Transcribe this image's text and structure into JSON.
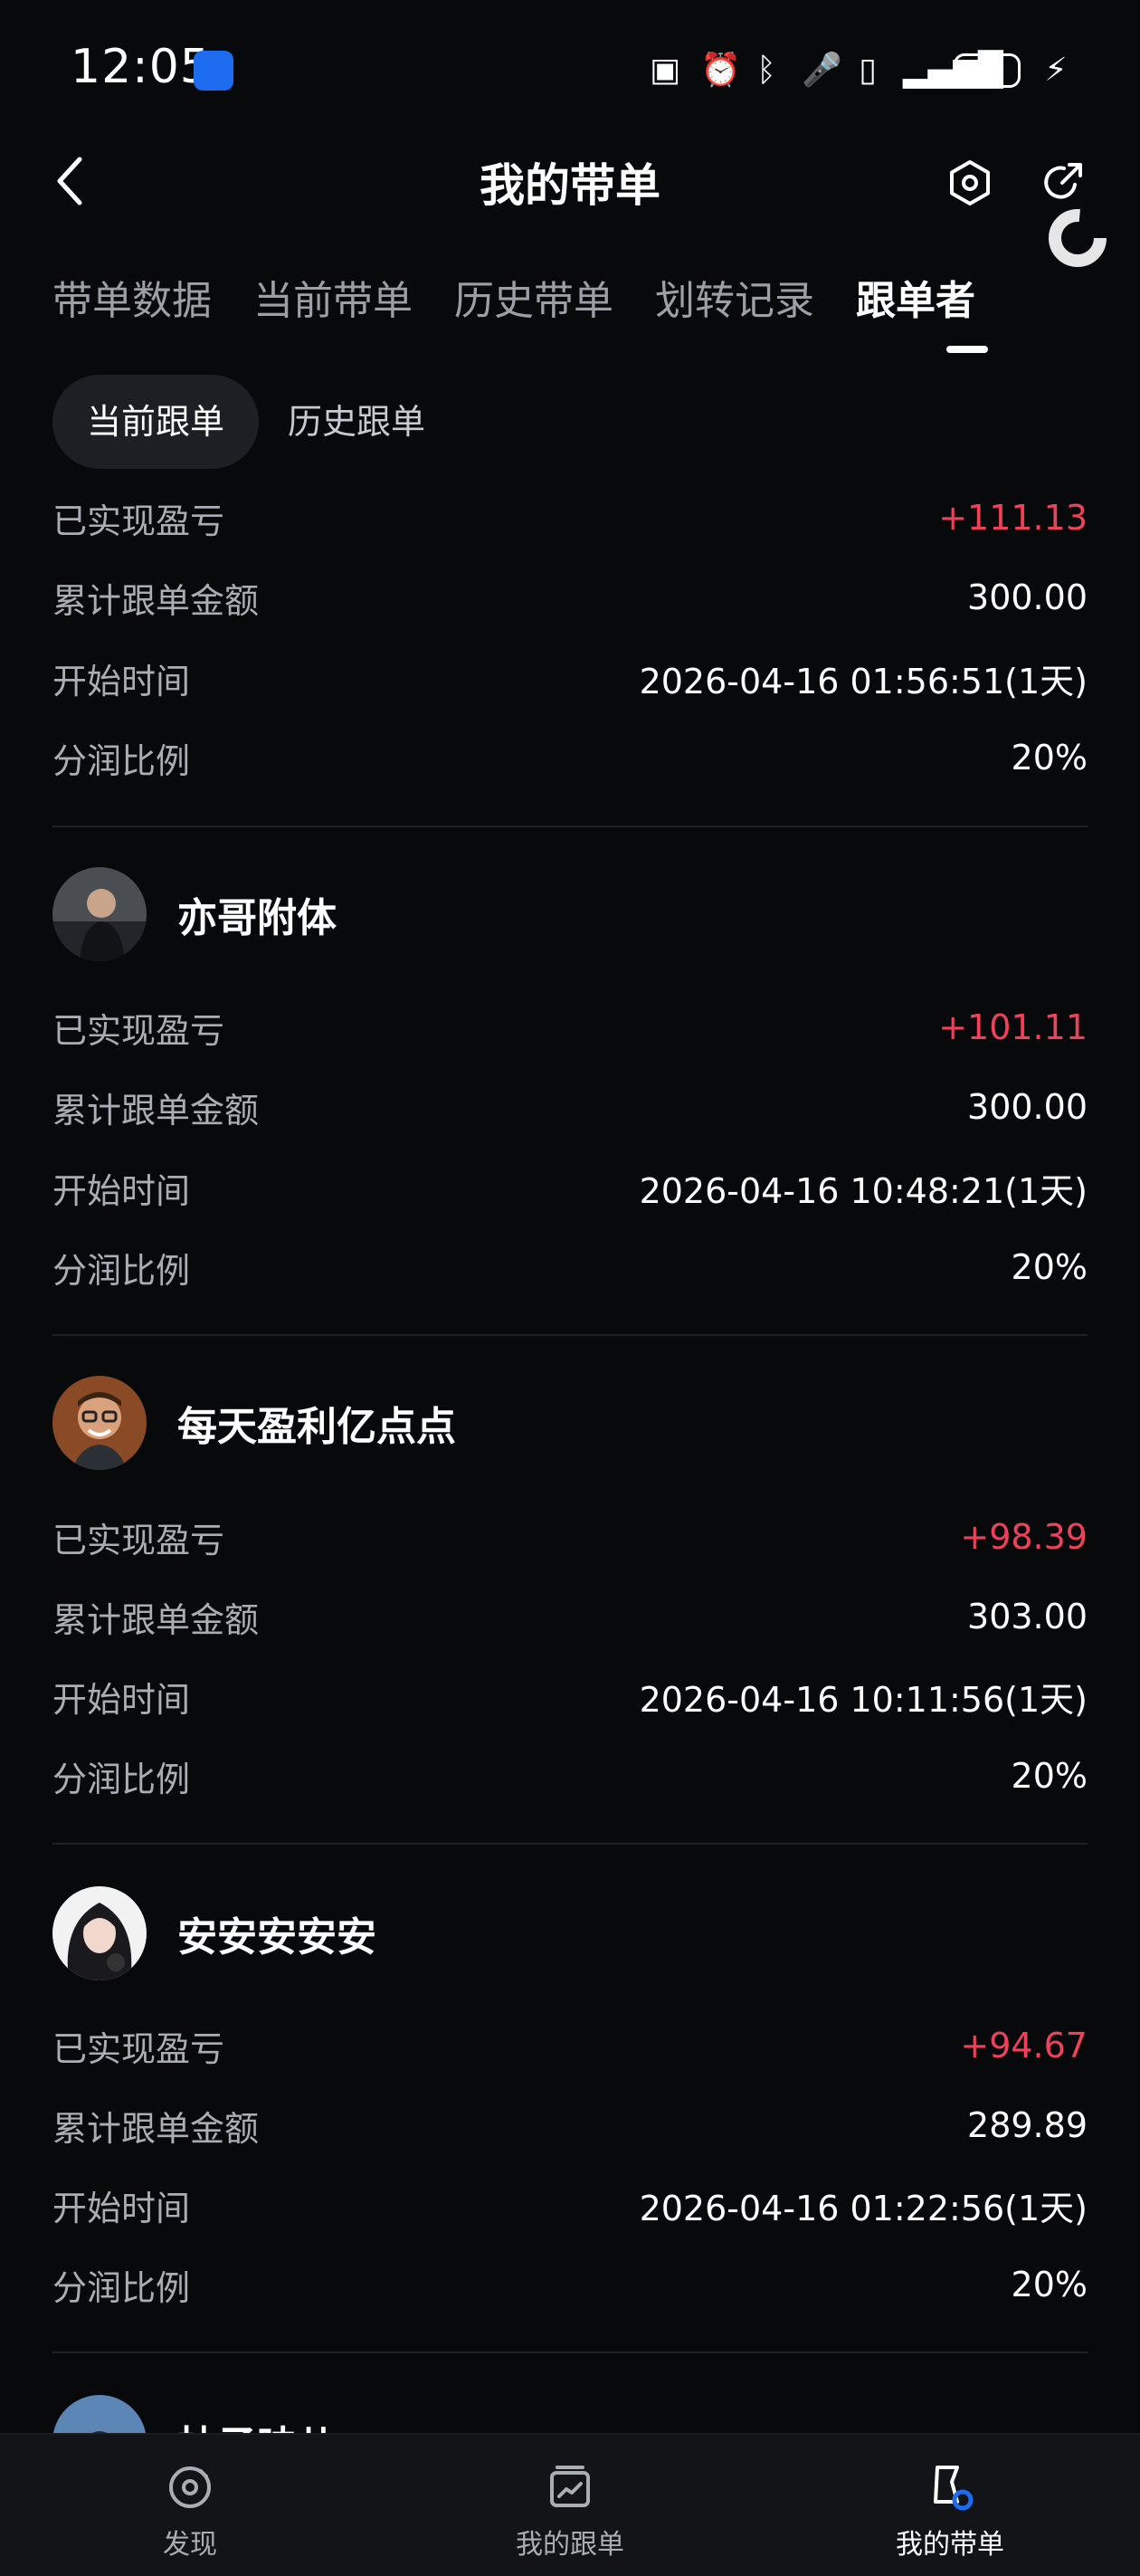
{
  "status_bar": {
    "time": "12:05",
    "battery": "20"
  },
  "header": {
    "title": "我的带单"
  },
  "tabs": [
    {
      "label": "带单数据"
    },
    {
      "label": "当前带单"
    },
    {
      "label": "历史带单"
    },
    {
      "label": "划转记录"
    },
    {
      "label": "跟单者"
    }
  ],
  "subtabs": {
    "active": "当前跟单",
    "inactive": "历史跟单"
  },
  "labels": {
    "pnl": "已实现盈亏",
    "amount": "累计跟单金额",
    "start": "开始时间",
    "share": "分润比例"
  },
  "followers": [
    {
      "name": "",
      "pnl": "+111.13",
      "amount": "300.00",
      "start": "2026-04-16 01:56:51(1天)",
      "share": "20%"
    },
    {
      "name": "亦哥附体",
      "pnl": "+101.11",
      "amount": "300.00",
      "start": "2026-04-16 10:48:21(1天)",
      "share": "20%"
    },
    {
      "name": "每天盈利亿点点",
      "pnl": "+98.39",
      "amount": "303.00",
      "start": "2026-04-16 10:11:56(1天)",
      "share": "20%"
    },
    {
      "name": "安安安安安",
      "pnl": "+94.67",
      "amount": "289.89",
      "start": "2026-04-16 01:22:56(1天)",
      "share": "20%"
    }
  ],
  "partial_follower": {
    "name": "柚子味儿"
  },
  "colors": {
    "positive": "#f0415a",
    "accent": "#1d6cf0"
  },
  "bottom_nav": [
    {
      "label": "发现",
      "icon": "discover-icon"
    },
    {
      "label": "我的跟单",
      "icon": "copy-trade-icon"
    },
    {
      "label": "我的带单",
      "icon": "lead-trade-icon"
    }
  ]
}
